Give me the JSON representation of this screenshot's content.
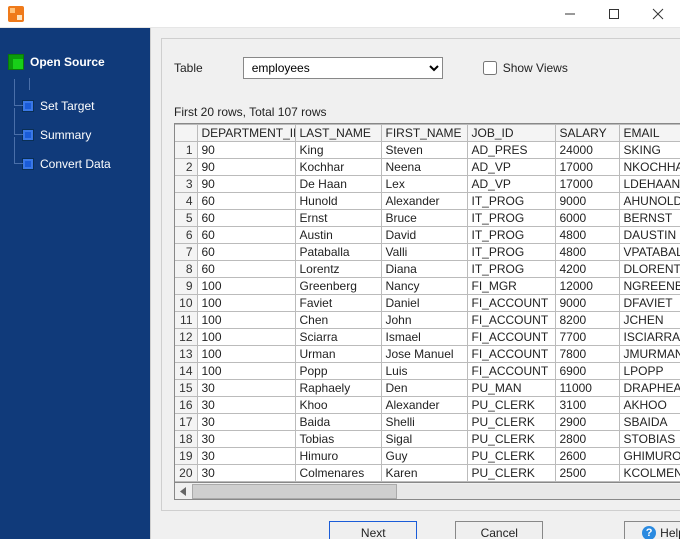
{
  "titlebar": {
    "title": ""
  },
  "sidebar": {
    "steps": [
      {
        "label": "Open Source"
      },
      {
        "label": "Set Target"
      },
      {
        "label": "Summary"
      },
      {
        "label": "Convert Data"
      }
    ]
  },
  "table_control": {
    "label": "Table",
    "selected": "employees",
    "show_views_label": "Show Views",
    "show_views_checked": false
  },
  "status_line": "First 20 rows, Total 107 rows",
  "grid": {
    "columns": [
      "DEPARTMENT_ID",
      "LAST_NAME",
      "FIRST_NAME",
      "JOB_ID",
      "SALARY",
      "EMAIL"
    ],
    "rows": [
      [
        "90",
        "King",
        "Steven",
        "AD_PRES",
        "24000",
        "SKING"
      ],
      [
        "90",
        "Kochhar",
        "Neena",
        "AD_VP",
        "17000",
        "NKOCHHAR"
      ],
      [
        "90",
        "De Haan",
        "Lex",
        "AD_VP",
        "17000",
        "LDEHAAN"
      ],
      [
        "60",
        "Hunold",
        "Alexander",
        "IT_PROG",
        "9000",
        "AHUNOLD"
      ],
      [
        "60",
        "Ernst",
        "Bruce",
        "IT_PROG",
        "6000",
        "BERNST"
      ],
      [
        "60",
        "Austin",
        "David",
        "IT_PROG",
        "4800",
        "DAUSTIN"
      ],
      [
        "60",
        "Pataballa",
        "Valli",
        "IT_PROG",
        "4800",
        "VPATABAL"
      ],
      [
        "60",
        "Lorentz",
        "Diana",
        "IT_PROG",
        "4200",
        "DLORENTZ"
      ],
      [
        "100",
        "Greenberg",
        "Nancy",
        "FI_MGR",
        "12000",
        "NGREENBE"
      ],
      [
        "100",
        "Faviet",
        "Daniel",
        "FI_ACCOUNT",
        "9000",
        "DFAVIET"
      ],
      [
        "100",
        "Chen",
        "John",
        "FI_ACCOUNT",
        "8200",
        "JCHEN"
      ],
      [
        "100",
        "Sciarra",
        "Ismael",
        "FI_ACCOUNT",
        "7700",
        "ISCIARRA"
      ],
      [
        "100",
        "Urman",
        "Jose Manuel",
        "FI_ACCOUNT",
        "7800",
        "JMURMAN"
      ],
      [
        "100",
        "Popp",
        "Luis",
        "FI_ACCOUNT",
        "6900",
        "LPOPP"
      ],
      [
        "30",
        "Raphaely",
        "Den",
        "PU_MAN",
        "11000",
        "DRAPHEAL"
      ],
      [
        "30",
        "Khoo",
        "Alexander",
        "PU_CLERK",
        "3100",
        "AKHOO"
      ],
      [
        "30",
        "Baida",
        "Shelli",
        "PU_CLERK",
        "2900",
        "SBAIDA"
      ],
      [
        "30",
        "Tobias",
        "Sigal",
        "PU_CLERK",
        "2800",
        "STOBIAS"
      ],
      [
        "30",
        "Himuro",
        "Guy",
        "PU_CLERK",
        "2600",
        "GHIMURO"
      ],
      [
        "30",
        "Colmenares",
        "Karen",
        "PU_CLERK",
        "2500",
        "KCOLMENA"
      ]
    ]
  },
  "footer": {
    "next": "Next",
    "cancel": "Cancel",
    "help": "Help"
  }
}
